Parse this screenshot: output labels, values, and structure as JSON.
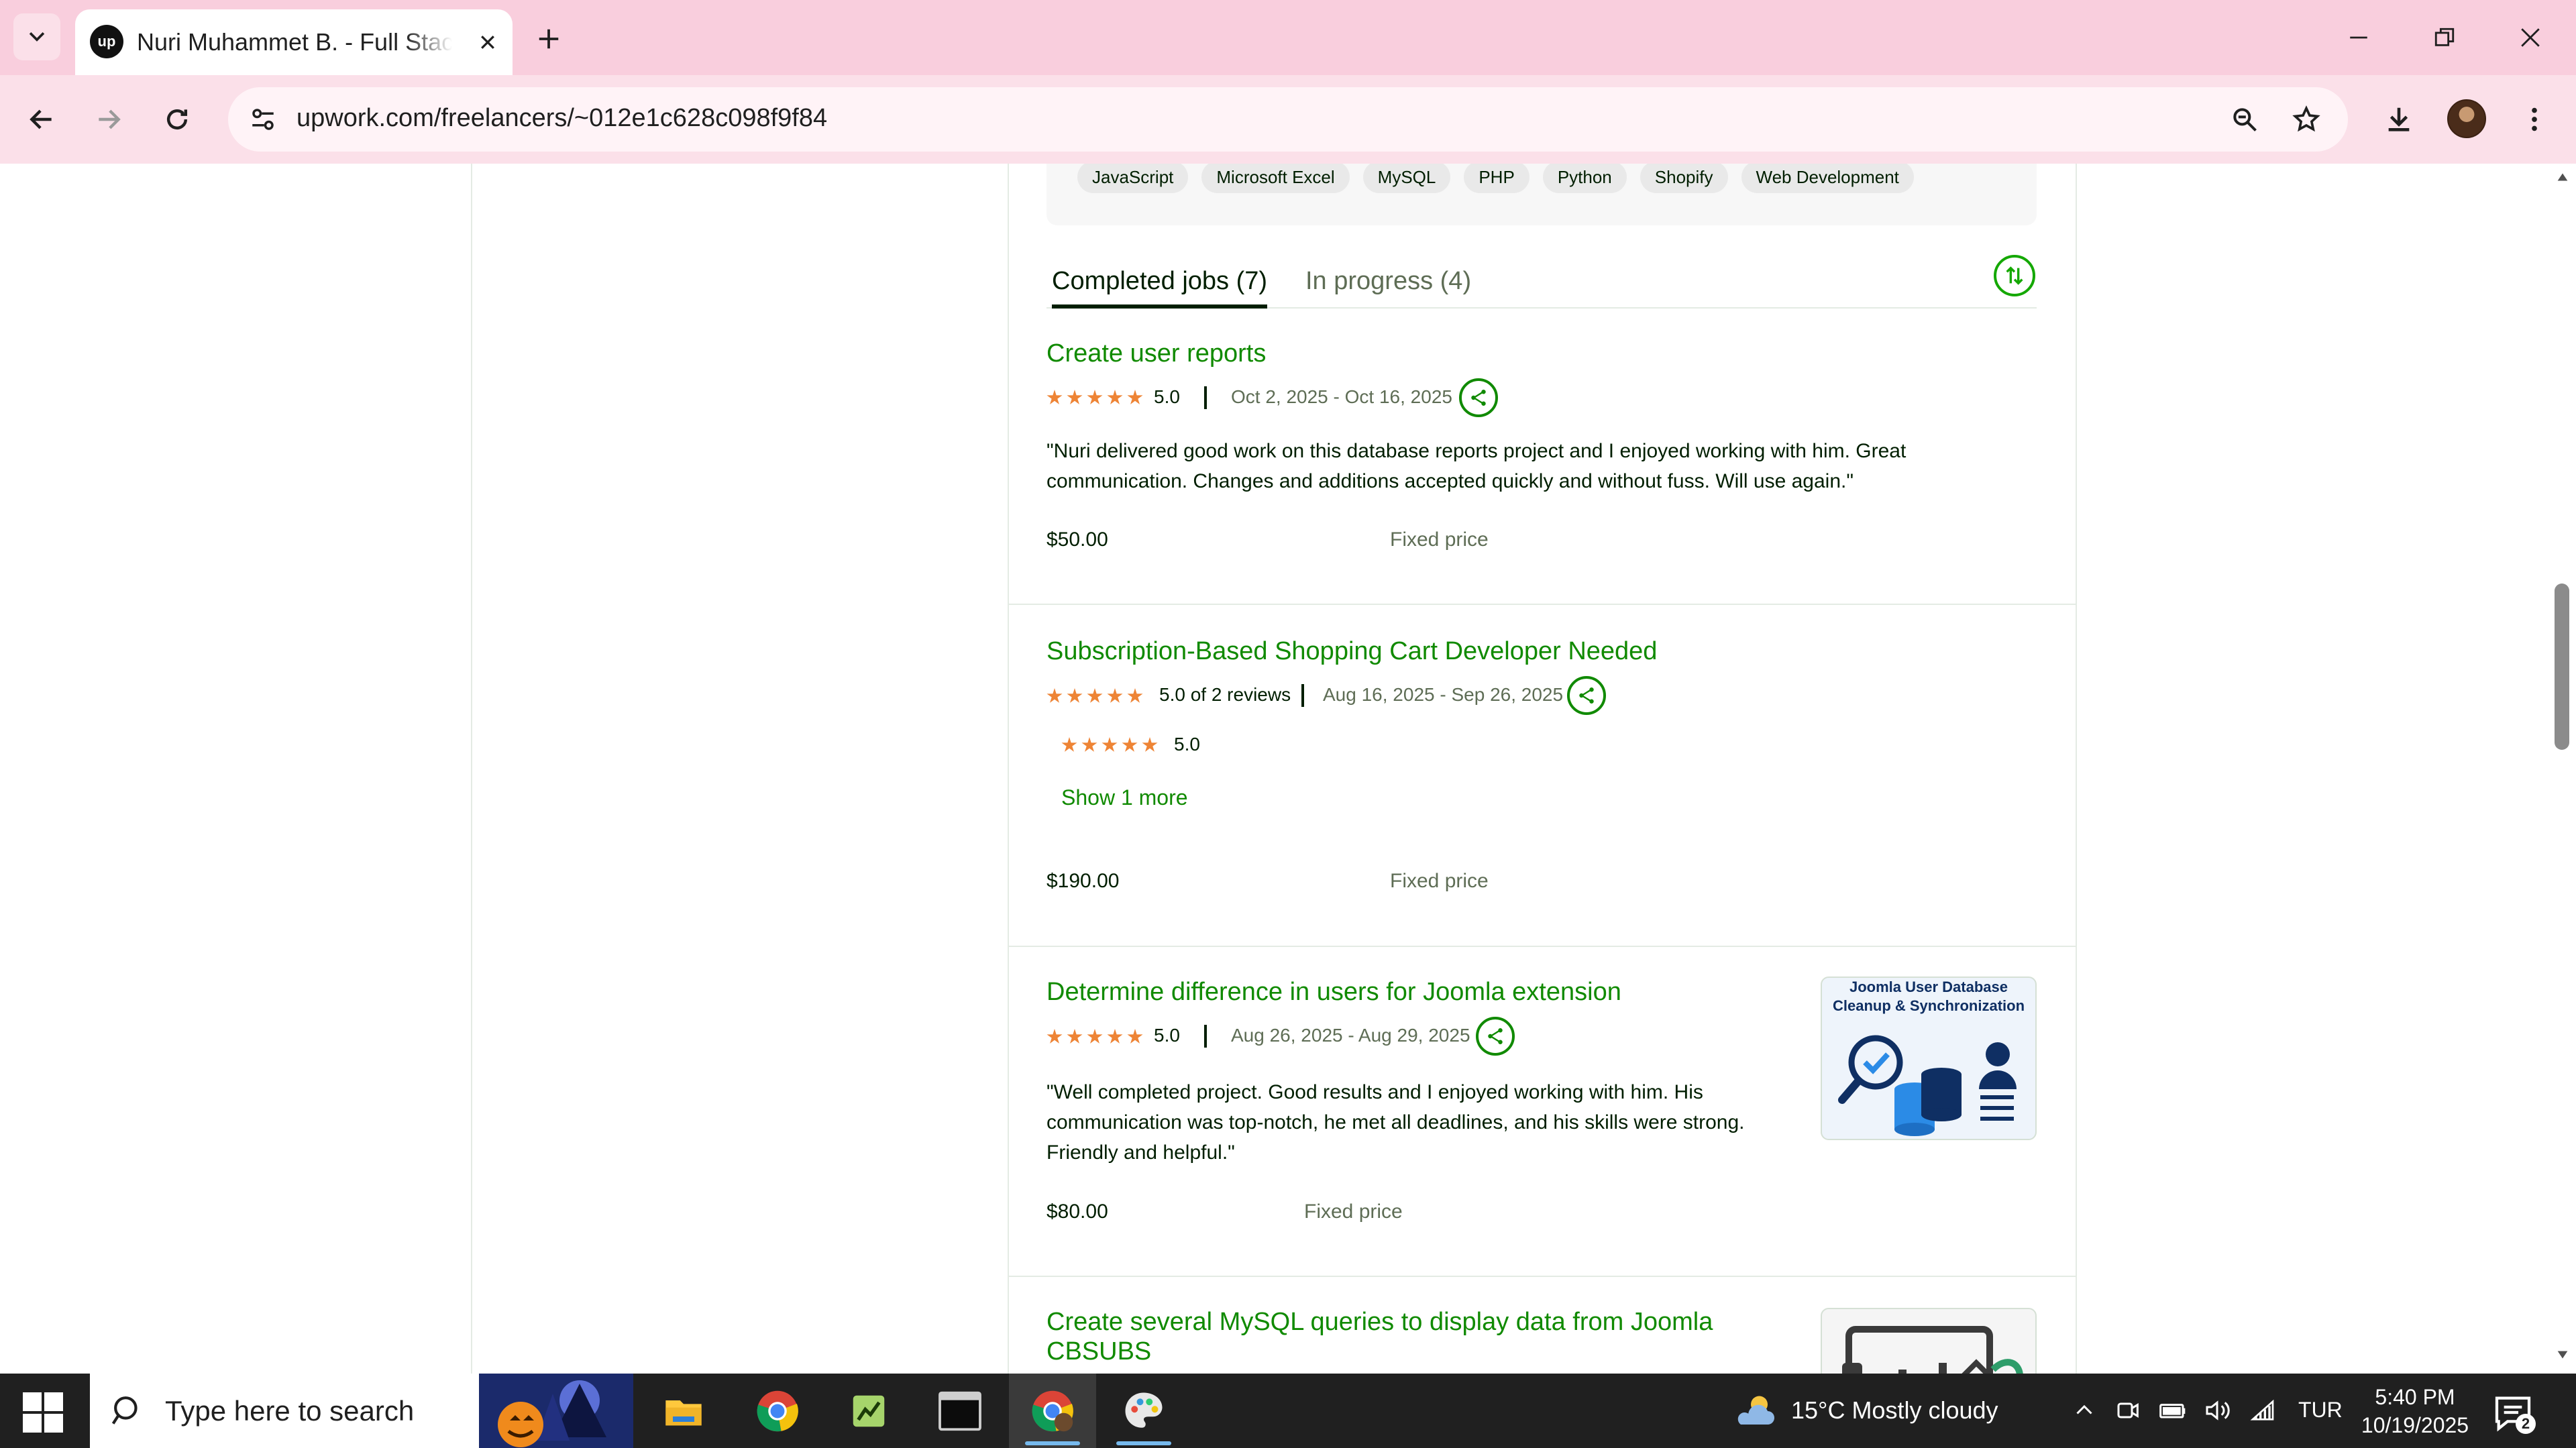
{
  "browser": {
    "tab_title": "Nuri Muhammet B. - Full Stack Developer",
    "favicon_text": "up",
    "url": "upwork.com/freelancers/~012e1c628c098f9f84"
  },
  "skills": [
    "JavaScript",
    "Microsoft Excel",
    "MySQL",
    "PHP",
    "Python",
    "Shopify",
    "Web Development"
  ],
  "job_tabs": {
    "completed": "Completed jobs (7)",
    "in_progress": "In progress (4)"
  },
  "jobs": [
    {
      "title": "Create user reports",
      "rating": "5.0",
      "dates": "Oct 2, 2025 - Oct 16, 2025",
      "review": "\"Nuri delivered good work on this database reports project and I enjoyed working with him. Great communication. Changes and additions accepted quickly and without fuss. Will use again.\"",
      "price": "$50.00",
      "price_type": "Fixed price"
    },
    {
      "title": "Subscription-Based Shopping Cart Developer Needed",
      "rating": "5.0 of 2 reviews",
      "dates": "Aug 16, 2025 - Sep 26, 2025",
      "sub_rating": "5.0",
      "show_more": "Show 1 more",
      "price": "$190.00",
      "price_type": "Fixed price"
    },
    {
      "title": "Determine difference in users for Joomla extension",
      "rating": "5.0",
      "dates": "Aug 26, 2025 - Aug 29, 2025",
      "review": "\"Well completed project. Good results and I enjoyed working with him. His communication was top-notch, he met all deadlines, and his skills were strong. Friendly and helpful.\"",
      "price": "$80.00",
      "price_type": "Fixed price",
      "thumbnail_caption": "Joomla User Database Cleanup & Synchronization"
    },
    {
      "title_line1": "Create several MySQL queries to display data from Joomla",
      "title_line2": "CBSUBS"
    }
  ],
  "taskbar": {
    "search_placeholder": "Type here to search",
    "weather": "15°C  Mostly cloudy",
    "language": "TUR",
    "time": "5:40 PM",
    "date": "10/19/2025",
    "notification_count": "2"
  },
  "colors": {
    "tabstrip": "#f9cedd",
    "toolbar": "#fbe0e9",
    "upwork_green": "#108a00",
    "star": "#ee8435",
    "taskbar": "#202020"
  }
}
